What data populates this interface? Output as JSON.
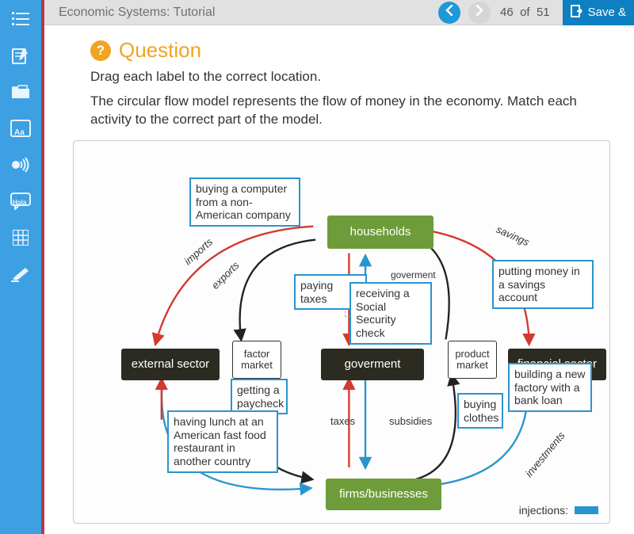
{
  "header": {
    "title": "Economic Systems: Tutorial",
    "page_current": 46,
    "page_word_of": "of",
    "page_total": 51,
    "save_label": "Save &"
  },
  "sidebar": {
    "items": [
      {
        "name": "menu",
        "glyph": "list"
      },
      {
        "name": "compose",
        "glyph": "compose"
      },
      {
        "name": "folder",
        "glyph": "folder"
      },
      {
        "name": "dictionary",
        "glyph": "Aa",
        "badge": "Aa"
      },
      {
        "name": "audio",
        "glyph": "audio"
      },
      {
        "name": "translate",
        "glyph": "chat",
        "badge": "Hola"
      },
      {
        "name": "calculator",
        "glyph": "grid"
      },
      {
        "name": "highlight",
        "glyph": "marker"
      }
    ]
  },
  "question": {
    "icon_text": "?",
    "title": "Question",
    "instruction": "Drag each label to the correct location.",
    "body": "The circular flow model represents the flow of money in the economy. Match each activity to the correct part of the model."
  },
  "diagram": {
    "nodes": {
      "households": "households",
      "goverment": "goverment",
      "firms": "firms/businesses",
      "external": "external sector",
      "financial": "financial sector",
      "factor": "factor market",
      "product": "product market"
    },
    "flow_labels": {
      "imports": "imports",
      "exports": "exports",
      "savings": "savings",
      "investments": "investments",
      "taxes": "taxes",
      "subsidies": "subsidies",
      "goverment_small": "goverment"
    },
    "legend": {
      "injections": "injections:"
    },
    "cards": {
      "computer_import": "buying a computer from a non-American company",
      "paying_taxes": "paying taxes",
      "social_security": "receiving a Social Security check",
      "savings_account": "putting money in a savings account",
      "paycheck": "getting a paycheck",
      "lunch_abroad": "having lunch at an American fast food restaurant in another country",
      "buying_clothes": "buying clothes",
      "bank_loan": "building a new factory with a bank loan"
    }
  }
}
